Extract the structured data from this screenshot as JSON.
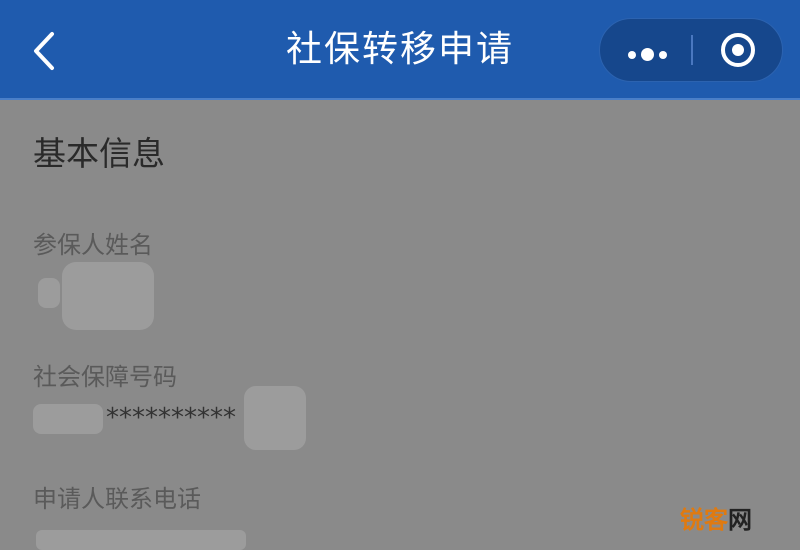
{
  "header": {
    "title": "社保转移申请",
    "background_color": "#1f5bae",
    "back_icon": "back-chevron-icon",
    "more_icon": "more-dots-icon",
    "close_icon": "miniprogram-close-icon"
  },
  "section": {
    "title": "基本信息"
  },
  "fields": [
    {
      "label": "参保人姓名",
      "value": ""
    },
    {
      "label": "社会保障号码",
      "value": "**********"
    },
    {
      "label": "申请人联系电话",
      "value": ""
    }
  ],
  "watermark": {
    "text_colored": "锐客",
    "text_plain": "网"
  }
}
